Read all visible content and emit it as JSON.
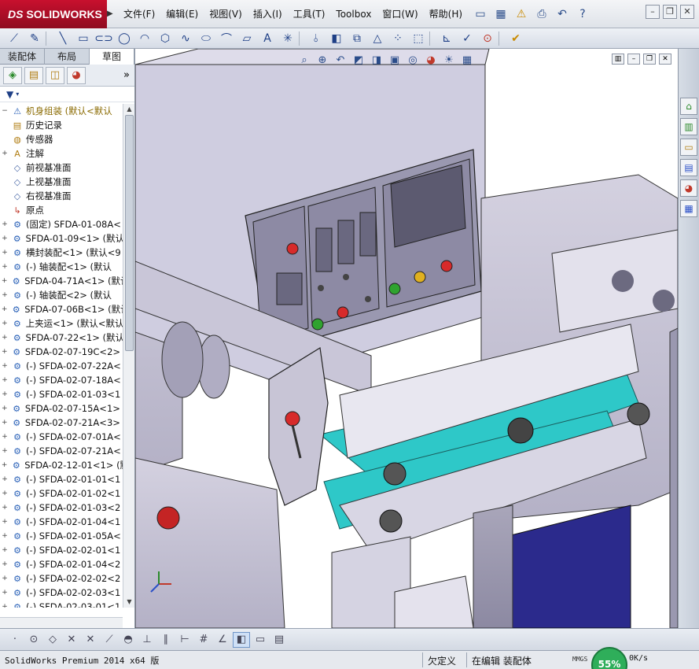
{
  "app": {
    "brand": "SOLIDWORKS",
    "brand_prefix": "DS"
  },
  "menu": {
    "items": [
      "文件(F)",
      "编辑(E)",
      "视图(V)",
      "插入(I)",
      "工具(T)",
      "Toolbox",
      "窗口(W)",
      "帮助(H)"
    ]
  },
  "cm_tabs": [
    "装配体",
    "布局",
    "草图"
  ],
  "feature_tree": {
    "root": "机身组装 (默认<默认",
    "rows": [
      {
        "label": "历史记录",
        "icon": "history-folder-icon",
        "exp": ""
      },
      {
        "label": "传感器",
        "icon": "sensor-folder-icon",
        "exp": ""
      },
      {
        "label": "注解",
        "icon": "annotation-folder-icon",
        "exp": "+"
      },
      {
        "label": "前视基准面",
        "icon": "plane-icon",
        "exp": ""
      },
      {
        "label": "上视基准面",
        "icon": "plane-icon",
        "exp": ""
      },
      {
        "label": "右视基准面",
        "icon": "plane-icon",
        "exp": ""
      },
      {
        "label": "原点",
        "icon": "origin-icon",
        "exp": ""
      },
      {
        "label": "(固定) SFDA-01-08A<",
        "icon": "assembly-icon",
        "exp": "+"
      },
      {
        "label": "SFDA-01-09<1> (默认",
        "icon": "assembly-icon",
        "exp": "+"
      },
      {
        "label": "横封装配<1> (默认<9",
        "icon": "assembly-icon",
        "exp": "+"
      },
      {
        "label": "(-) 轴装配<1> (默认",
        "icon": "assembly-icon",
        "exp": "+"
      },
      {
        "label": "SFDA-04-71A<1> (默认",
        "icon": "assembly-icon",
        "exp": "+"
      },
      {
        "label": "(-) 轴装配<2> (默认",
        "icon": "assembly-icon",
        "exp": "+"
      },
      {
        "label": "SFDA-07-06B<1> (默认",
        "icon": "assembly-icon",
        "exp": "+"
      },
      {
        "label": "上夹运<1> (默认<默认",
        "icon": "assembly-icon",
        "exp": "+"
      },
      {
        "label": "SFDA-07-22<1> (默认",
        "icon": "assembly-icon",
        "exp": "+"
      },
      {
        "label": "SFDA-02-07-19C<2> (",
        "icon": "assembly-icon",
        "exp": "+"
      },
      {
        "label": "(-) SFDA-02-07-22A<",
        "icon": "assembly-icon",
        "exp": "+"
      },
      {
        "label": "(-) SFDA-02-07-18A<",
        "icon": "assembly-icon",
        "exp": "+"
      },
      {
        "label": "(-) SFDA-02-01-03<1",
        "icon": "assembly-icon",
        "exp": "+"
      },
      {
        "label": "SFDA-02-07-15A<1> (",
        "icon": "assembly-icon",
        "exp": "+"
      },
      {
        "label": "SFDA-02-07-21A<3> (",
        "icon": "assembly-icon",
        "exp": "+"
      },
      {
        "label": "(-) SFDA-02-07-01A<",
        "icon": "assembly-icon",
        "exp": "+"
      },
      {
        "label": "(-) SFDA-02-07-21A<",
        "icon": "assembly-icon",
        "exp": "+"
      },
      {
        "label": "SFDA-02-12-01<1> (默",
        "icon": "assembly-icon",
        "exp": "+"
      },
      {
        "label": "(-) SFDA-02-01-01<1",
        "icon": "assembly-icon",
        "exp": "+"
      },
      {
        "label": "(-) SFDA-02-01-02<1",
        "icon": "assembly-icon",
        "exp": "+"
      },
      {
        "label": "(-) SFDA-02-01-03<2",
        "icon": "assembly-icon",
        "exp": "+"
      },
      {
        "label": "(-) SFDA-02-01-04<1",
        "icon": "assembly-icon",
        "exp": "+"
      },
      {
        "label": "(-) SFDA-02-01-05A<",
        "icon": "assembly-icon",
        "exp": "+"
      },
      {
        "label": "(-) SFDA-02-02-01<1",
        "icon": "assembly-icon",
        "exp": "+"
      },
      {
        "label": "(-) SFDA-02-01-04<2",
        "icon": "assembly-icon",
        "exp": "+"
      },
      {
        "label": "(-) SFDA-02-02-02<2",
        "icon": "assembly-icon",
        "exp": "+"
      },
      {
        "label": "(-) SFDA-02-02-03<1",
        "icon": "assembly-icon",
        "exp": "+"
      },
      {
        "label": "(-) SFDA-02-03-01<1",
        "icon": "assembly-icon",
        "exp": "+"
      }
    ]
  },
  "statusbar": {
    "product": "SolidWorks Premium 2014 x64 版",
    "state": "欠定义",
    "editing": "在编辑 装配体",
    "units": "MMGS",
    "gauge": "55%",
    "net": "0K/s"
  },
  "colors": {
    "accent": "#c8102e",
    "machine_body": "#bfbccd",
    "belt": "#2ec8c8",
    "panel_blue": "#2b2a8c"
  }
}
